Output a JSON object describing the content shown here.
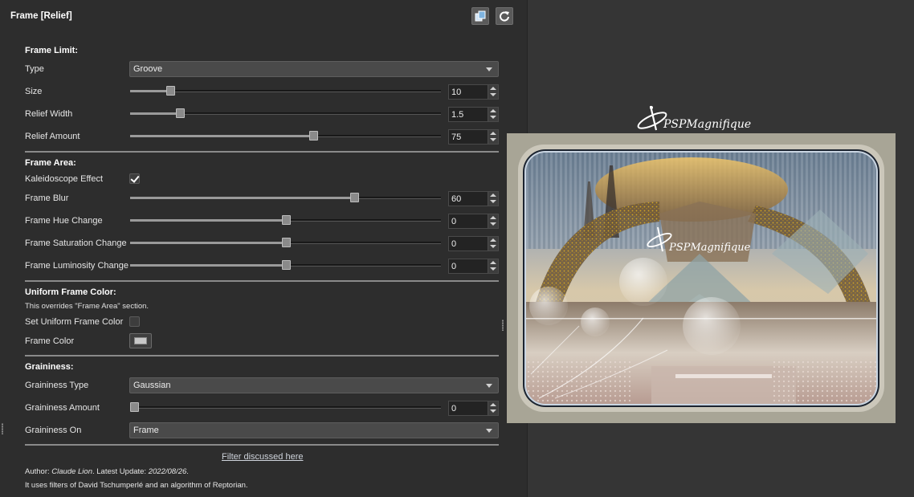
{
  "window": {
    "title": "Frame [Relief]"
  },
  "toolbar": {
    "copy_icon": "copy-icon",
    "reset_icon": "refresh-icon"
  },
  "frame_limit": {
    "heading": "Frame Limit:",
    "type": {
      "label": "Type",
      "value": "Groove"
    },
    "size": {
      "label": "Size",
      "value": "10",
      "fraction": 0.13
    },
    "relief_width": {
      "label": "Relief Width",
      "value": "1.5",
      "fraction": 0.16
    },
    "relief_amount": {
      "label": "Relief Amount",
      "value": "75",
      "fraction": 0.59
    }
  },
  "frame_area": {
    "heading": "Frame Area:",
    "kaleidoscope": {
      "label": "Kaleidoscope Effect",
      "checked": true
    },
    "blur": {
      "label": "Frame Blur",
      "value": "60",
      "fraction": 0.72
    },
    "hue": {
      "label": "Frame Hue Change",
      "value": "0",
      "fraction": 0.5
    },
    "saturation": {
      "label": "Frame Saturation Change",
      "value": "0",
      "fraction": 0.5
    },
    "luminosity": {
      "label": "Frame Luminosity Change",
      "value": "0",
      "fraction": 0.5
    }
  },
  "uniform_color": {
    "heading": "Uniform Frame Color:",
    "note": "This overrides \"Frame Area\" section.",
    "set_uniform": {
      "label": "Set Uniform Frame Color",
      "checked": false
    },
    "frame_color": {
      "label": "Frame Color",
      "color": "#c8c8c8"
    }
  },
  "graininess": {
    "heading": "Graininess:",
    "type": {
      "label": "Graininess Type",
      "value": "Gaussian"
    },
    "amount": {
      "label": "Graininess Amount",
      "value": "0",
      "fraction": 0.0
    },
    "on": {
      "label": "Graininess On",
      "value": "Frame"
    }
  },
  "footer": {
    "link": "Filter discussed here",
    "author_prefix": "Author: ",
    "author_name": "Claude Lion",
    "update_prefix": ". Latest Update: ",
    "update_date": "2022/08/26",
    "update_suffix": ".",
    "credits": "It uses filters of David Tschumperlé and an algorithm of Reptorian."
  },
  "preview": {
    "watermark": "PSPMagnifique",
    "frame_color": "#a8a596",
    "image_description_icon": "preview-image"
  }
}
